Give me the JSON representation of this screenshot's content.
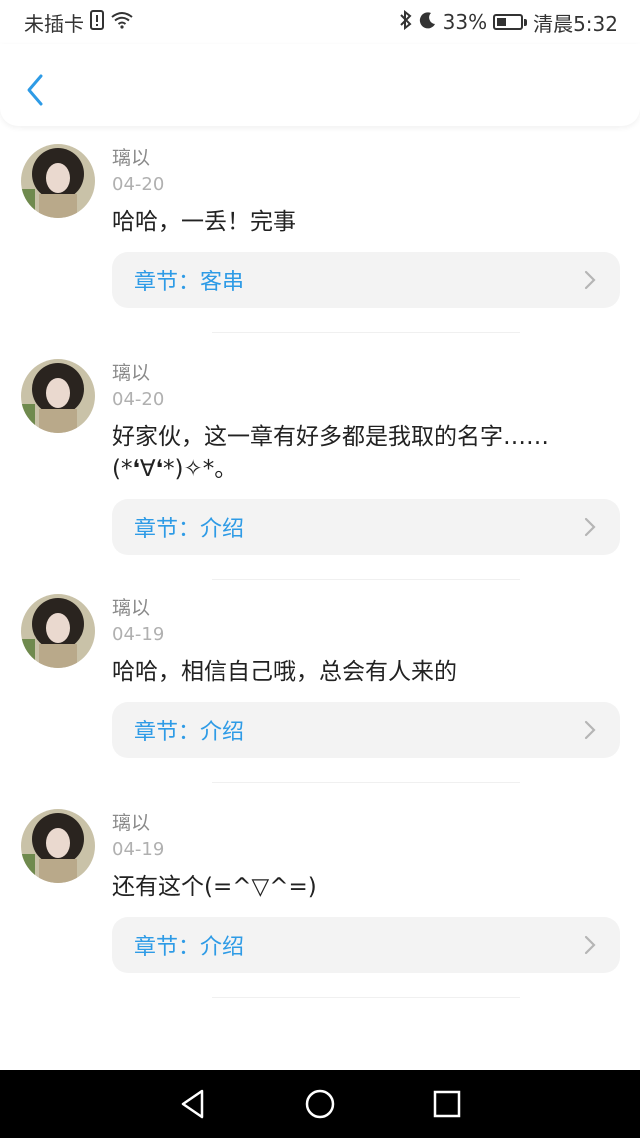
{
  "status_bar": {
    "carrier": "未插卡",
    "battery_percent": "33%",
    "time": "清晨5:32",
    "battery_level": 0.33
  },
  "header": {
    "back_icon": "chevron-left-icon",
    "accent": "#2e9be6"
  },
  "comments": [
    {
      "name": "璃以",
      "date": "04-20",
      "text": "哈哈，一丢！完事",
      "chapter": "章节：客串"
    },
    {
      "name": "璃以",
      "date": "04-20",
      "text": "好家伙，这一章有好多都是我取的名字……(*❛∀❛*)✧*。",
      "chapter": "章节：介绍"
    },
    {
      "name": "璃以",
      "date": "04-19",
      "text": "哈哈，相信自己哦，总会有人来的",
      "chapter": "章节：介绍"
    },
    {
      "name": "璃以",
      "date": "04-19",
      "text": "还有这个(=^▽^=)",
      "chapter": "章节：介绍"
    }
  ],
  "nav": {
    "back_icon": "triangle-back-icon",
    "home_icon": "circle-home-icon",
    "recents_icon": "square-recents-icon"
  }
}
